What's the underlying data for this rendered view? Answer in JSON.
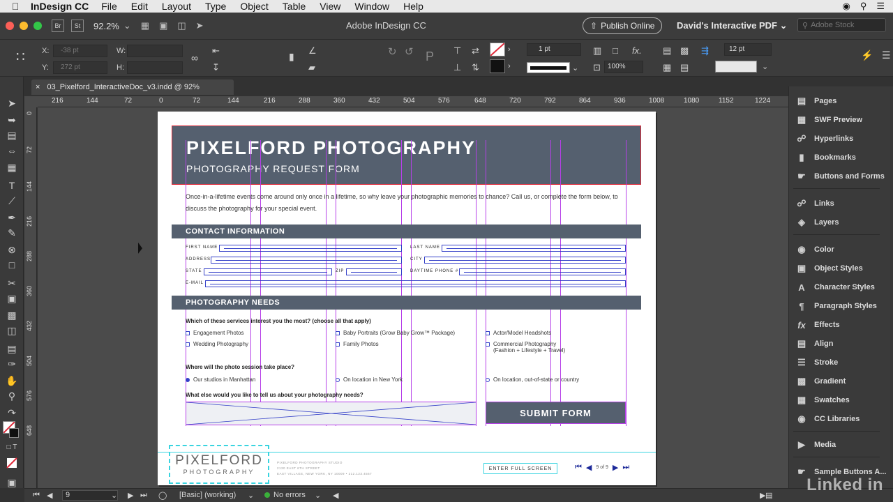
{
  "menubar": {
    "app_name": "InDesign CC",
    "items": [
      "File",
      "Edit",
      "Layout",
      "Type",
      "Object",
      "Table",
      "View",
      "Window",
      "Help"
    ]
  },
  "appbar": {
    "br_label": "Br",
    "st_label": "St",
    "zoom": "92.2%",
    "title": "Adobe InDesign CC",
    "publish_label": "Publish Online",
    "workspace": "David's Interactive PDF",
    "stock_placeholder": "Adobe Stock"
  },
  "control": {
    "x_label": "X:",
    "x_value": "-38 pt",
    "y_label": "Y:",
    "y_value": "272 pt",
    "w_label": "W:",
    "h_label": "H:",
    "stroke_weight": "1 pt",
    "opacity": "100%",
    "gutter": "12 pt"
  },
  "document": {
    "tab_title": "03_Pixelford_InteractiveDoc_v3.indd @ 92%",
    "close_glyph": "×"
  },
  "ruler": {
    "h_ticks": [
      "216",
      "144",
      "72",
      "0",
      "72",
      "144",
      "216",
      "288",
      "360",
      "432",
      "504",
      "576",
      "648",
      "720",
      "792",
      "864",
      "936",
      "1008",
      "1080",
      "1152",
      "1224"
    ],
    "v_ticks": [
      "0",
      "72",
      "144",
      "216",
      "288",
      "360",
      "432",
      "504",
      "576",
      "648"
    ]
  },
  "page": {
    "title": "PIXELFORD PHOTOGRAPHY",
    "subtitle": "PHOTOGRAPHY REQUEST FORM",
    "intro": "Once-in-a-lifetime events come around only once in a lifetime, so why leave your photographic memories to chance? Call us, or complete the form below, to discuss the photography for your special event.",
    "contact_heading": "CONTACT INFORMATION",
    "fields": {
      "first_name": "FIRST NAME",
      "last_name": "LAST NAME",
      "address": "ADDRESS",
      "city": "CITY",
      "state": "STATE",
      "zip": "ZIP",
      "daytime_phone": "DAYTIME PHONE #",
      "email": "E-MAIL"
    },
    "needs_heading": "PHOTOGRAPHY NEEDS",
    "q1": "Which of these services interest you the most? (choose all that apply)",
    "services": [
      "Engagement Photos",
      "Wedding Photography",
      "Baby Portraits (Grow Baby Grow™ Package)",
      "Family Photos",
      "Actor/Model Headshots",
      "Commercial Photography",
      "(Fashion + Lifestyle + Travel)"
    ],
    "q2": "Where will the photo session take place?",
    "locations": [
      "Our studios in Manhattan",
      "On location in New York",
      "On location, out-of-state or country"
    ],
    "q3": "What else would you like to tell us about your photography needs?",
    "submit_label": "SUBMIT FORM",
    "footer_logo_1": "PIXELFORD",
    "footer_logo_2": "PHOTOGRAPHY",
    "footer_addr_1": "PIXELFORD PHOTOGRAPHY STUDIO",
    "footer_addr_2": "2130 EAST 6TH STREET",
    "footer_addr_3": "EAST VILLAGE, NEW YORK, NY 10009 • 212.123.4567",
    "fullscreen_label": "ENTER FULL SCREEN",
    "pager_count": "9 of 9"
  },
  "panels": {
    "group1": [
      "Pages",
      "SWF Preview",
      "Hyperlinks",
      "Bookmarks",
      "Buttons and Forms"
    ],
    "group2": [
      "Links",
      "Layers"
    ],
    "group3": [
      "Color",
      "Object Styles",
      "Character Styles",
      "Paragraph Styles",
      "Effects",
      "Align",
      "Stroke",
      "Gradient",
      "Swatches",
      "CC Libraries"
    ],
    "group4": [
      "Media"
    ],
    "group5": [
      "Sample Buttons A..."
    ]
  },
  "statusbar": {
    "page_number": "9",
    "style": "[Basic] (working)",
    "preflight": "No errors"
  },
  "watermark": "Linked in"
}
